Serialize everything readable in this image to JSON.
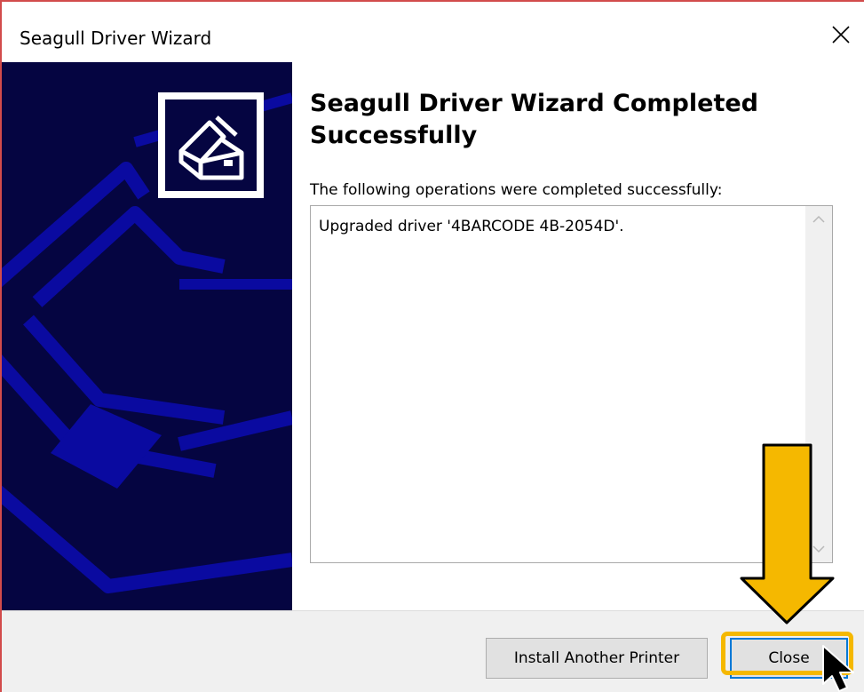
{
  "window": {
    "title": "Seagull Driver Wizard"
  },
  "icons": {
    "close": "close-icon",
    "printer_logo": "printer-icon",
    "scroll_up": "chevron-up-icon",
    "scroll_down": "chevron-down-icon",
    "mouse_pointer": "mouse-pointer-icon",
    "annotation_arrow": "arrow-down-icon"
  },
  "main": {
    "heading": "Seagull Driver Wizard Completed Successfully",
    "operations_label": "The following operations were completed successfully:",
    "operations": [
      "Upgraded driver '4BARCODE 4B-2054D'."
    ]
  },
  "footer": {
    "install_another_label": "Install Another Printer",
    "close_label": "Close"
  },
  "colors": {
    "sidebar_bg": "#050541",
    "sidebar_art": "#0a0aa0",
    "annotation_yellow": "#f5b800",
    "focus_blue": "#0078d7"
  }
}
